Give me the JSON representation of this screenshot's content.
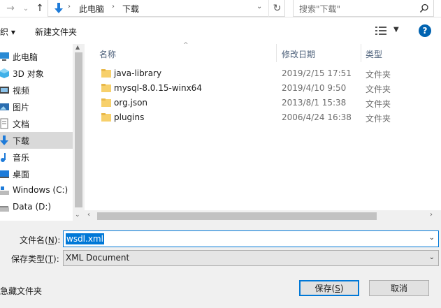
{
  "address": {
    "path": [
      "此电脑",
      "下载"
    ],
    "search_placeholder": "搜索\"下载\""
  },
  "toolbar": {
    "organize_label": "织 ▾",
    "new_folder_label": "新建文件夹",
    "help_glyph": "?"
  },
  "nav": {
    "items": [
      {
        "label": "此电脑",
        "icon": "computer-icon"
      },
      {
        "label": "3D 对象",
        "icon": "3d-objects-icon"
      },
      {
        "label": "视频",
        "icon": "video-icon"
      },
      {
        "label": "图片",
        "icon": "pictures-icon"
      },
      {
        "label": "文档",
        "icon": "documents-icon"
      },
      {
        "label": "下载",
        "icon": "downloads-icon",
        "selected": true
      },
      {
        "label": "音乐",
        "icon": "music-icon"
      },
      {
        "label": "桌面",
        "icon": "desktop-icon"
      },
      {
        "label": "Windows (C:)",
        "icon": "drive-icon"
      },
      {
        "label": "Data (D:)",
        "icon": "drive-icon"
      }
    ]
  },
  "file_list": {
    "columns": [
      "名称",
      "修改日期",
      "类型"
    ],
    "rows": [
      {
        "name": "java-library",
        "date": "2019/2/15 17:51",
        "type": "文件夹"
      },
      {
        "name": "mysql-8.0.15-winx64",
        "date": "2019/4/10 9:50",
        "type": "文件夹"
      },
      {
        "name": "org.json",
        "date": "2013/8/1 15:38",
        "type": "文件夹"
      },
      {
        "name": "plugins",
        "date": "2006/4/24 16:38",
        "type": "文件夹"
      }
    ]
  },
  "form": {
    "filename_label": "文件名(",
    "filename_key": "N",
    "filename_label_end": "):",
    "filename_value": "wsdl.xml",
    "filetype_label": "保存类型(",
    "filetype_key": "T",
    "filetype_label_end": "):",
    "filetype_value": "XML Document"
  },
  "footer": {
    "hide_folders_label": "急藏文件夹",
    "save_label": "保存(",
    "save_key": "S",
    "save_label_end": ")",
    "cancel_label": "取消"
  },
  "colors": {
    "accent": "#0078d7",
    "selection": "#d9d9d9",
    "help": "#0063b1"
  }
}
